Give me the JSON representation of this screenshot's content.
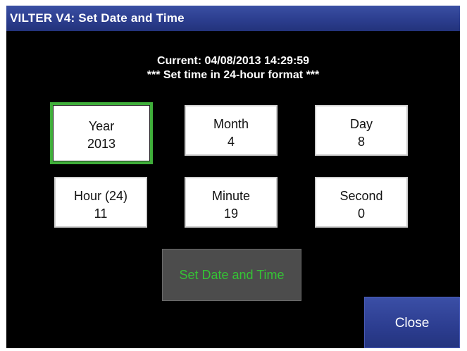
{
  "window": {
    "title": "VILTER V4: Set Date and Time"
  },
  "info": {
    "current": "Current: 04/08/2013 14:29:59",
    "format_note": "*** Set time in 24-hour format ***"
  },
  "fields": {
    "year": {
      "label": "Year",
      "value": "2013",
      "selected": true
    },
    "month": {
      "label": "Month",
      "value": "4"
    },
    "day": {
      "label": "Day",
      "value": "8"
    },
    "hour": {
      "label": "Hour (24)",
      "value": "11"
    },
    "minute": {
      "label": "Minute",
      "value": "19"
    },
    "second": {
      "label": "Second",
      "value": "0"
    }
  },
  "actions": {
    "set_label": "Set Date and Time",
    "close_label": "Close"
  },
  "colors": {
    "background": "#000000",
    "title_bar": "#2c3e8f",
    "selected_border": "#3fae3a",
    "set_button_bg": "#4c4c4c",
    "set_button_text": "#35c335",
    "close_button_bg": "#2c3d90"
  }
}
